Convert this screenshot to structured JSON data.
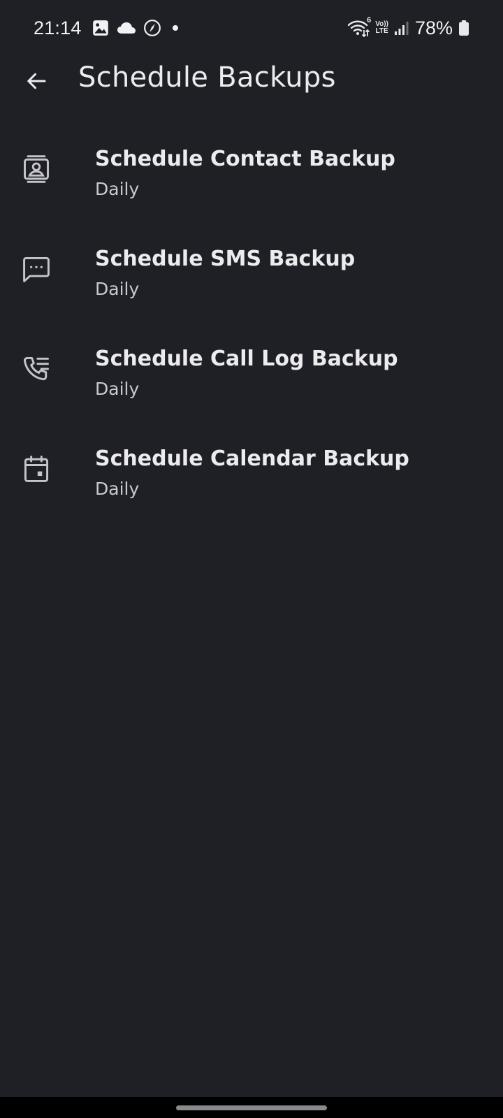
{
  "status_bar": {
    "time": "21:14",
    "battery_percent": "78%",
    "network_badge_top": "Vo))",
    "network_badge_bottom": "LTE",
    "wifi_badge": "6",
    "left_icons": [
      "gallery-icon",
      "cloud-icon",
      "compass-icon",
      "notification-dot-icon"
    ],
    "right_icons": [
      "wifi-icon",
      "volte-lte-icon",
      "signal-icon",
      "battery-icon"
    ]
  },
  "app_bar": {
    "title": "Schedule Backups",
    "back_icon": "arrow-back-icon"
  },
  "items": [
    {
      "icon": "contact-card-icon",
      "title": "Schedule Contact Backup",
      "subtitle": "Daily"
    },
    {
      "icon": "message-icon",
      "title": "Schedule SMS Backup",
      "subtitle": "Daily"
    },
    {
      "icon": "call-log-icon",
      "title": "Schedule Call Log Backup",
      "subtitle": "Daily"
    },
    {
      "icon": "calendar-icon",
      "title": "Schedule Calendar Backup",
      "subtitle": "Daily"
    }
  ],
  "colors": {
    "background": "#1f2025",
    "text_primary": "#ececef",
    "text_secondary": "#c9c9cf",
    "icon": "#c4c4ca",
    "nav_bar": "#000000"
  }
}
